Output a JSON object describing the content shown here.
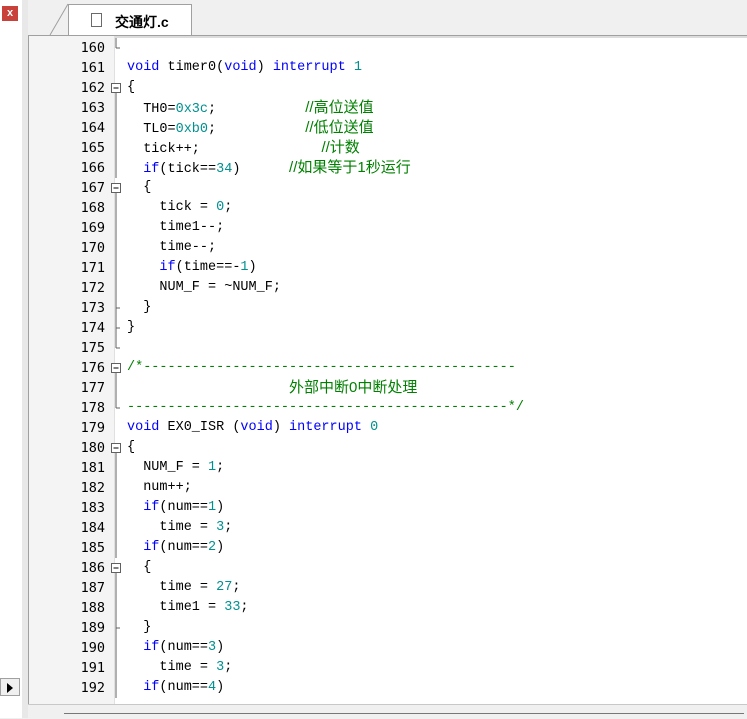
{
  "left_panel": {
    "close_glyph": "x"
  },
  "tab": {
    "label": "交通灯.c"
  },
  "editor": {
    "lines": [
      {
        "n": "160",
        "fold": "end",
        "tokens": []
      },
      {
        "n": "161",
        "fold": "",
        "tokens": [
          {
            "t": "void",
            "c": "kw"
          },
          {
            "t": " timer0("
          },
          {
            "t": "void",
            "c": "kw"
          },
          {
            "t": ") "
          },
          {
            "t": "interrupt",
            "c": "kw"
          },
          {
            "t": " "
          },
          {
            "t": "1",
            "c": "num"
          }
        ]
      },
      {
        "n": "162",
        "fold": "minus",
        "tokens": [
          {
            "t": "{"
          }
        ]
      },
      {
        "n": "163",
        "fold": "bar",
        "tokens": [
          {
            "t": "  TH0="
          },
          {
            "t": "0x3c",
            "c": "num"
          },
          {
            "t": ";           "
          },
          {
            "t": "//高位送值",
            "c": "cmt"
          }
        ]
      },
      {
        "n": "164",
        "fold": "bar",
        "tokens": [
          {
            "t": "  TL0="
          },
          {
            "t": "0xb0",
            "c": "num"
          },
          {
            "t": ";           "
          },
          {
            "t": "//低位送值",
            "c": "cmt"
          }
        ]
      },
      {
        "n": "165",
        "fold": "bar",
        "tokens": [
          {
            "t": "  tick++;               "
          },
          {
            "t": "//计数",
            "c": "cmt"
          }
        ]
      },
      {
        "n": "166",
        "fold": "bar",
        "tokens": [
          {
            "t": "  "
          },
          {
            "t": "if",
            "c": "kw"
          },
          {
            "t": "(tick=="
          },
          {
            "t": "34",
            "c": "num"
          },
          {
            "t": ")      "
          },
          {
            "t": "//如果等于1秒运行",
            "c": "cmt"
          }
        ]
      },
      {
        "n": "167",
        "fold": "minus",
        "tokens": [
          {
            "t": "  {"
          }
        ]
      },
      {
        "n": "168",
        "fold": "bar",
        "tokens": [
          {
            "t": "    tick = "
          },
          {
            "t": "0",
            "c": "num"
          },
          {
            "t": ";"
          }
        ]
      },
      {
        "n": "169",
        "fold": "bar",
        "tokens": [
          {
            "t": "    time1--;"
          }
        ]
      },
      {
        "n": "170",
        "fold": "bar",
        "tokens": [
          {
            "t": "    time--;"
          }
        ]
      },
      {
        "n": "171",
        "fold": "bar",
        "tokens": [
          {
            "t": "    "
          },
          {
            "t": "if",
            "c": "kw"
          },
          {
            "t": "(time==-"
          },
          {
            "t": "1",
            "c": "num"
          },
          {
            "t": ")"
          }
        ]
      },
      {
        "n": "172",
        "fold": "bar",
        "tokens": [
          {
            "t": "    NUM_F = ~NUM_F;"
          }
        ]
      },
      {
        "n": "173",
        "fold": "tick",
        "tokens": [
          {
            "t": "  }"
          }
        ]
      },
      {
        "n": "174",
        "fold": "tick",
        "tokens": [
          {
            "t": "}"
          }
        ]
      },
      {
        "n": "175",
        "fold": "end",
        "tokens": []
      },
      {
        "n": "176",
        "fold": "minus",
        "tokens": [
          {
            "t": "/*----------------------------------------------",
            "c": "cmtline"
          }
        ]
      },
      {
        "n": "177",
        "fold": "bar",
        "tokens": [
          {
            "t": "                    "
          },
          {
            "t": "外部中断0中断处理",
            "c": "cmt"
          }
        ]
      },
      {
        "n": "178",
        "fold": "end",
        "tokens": [
          {
            "t": "-----------------------------------------------*/",
            "c": "cmtline"
          }
        ]
      },
      {
        "n": "179",
        "fold": "",
        "tokens": [
          {
            "t": "void",
            "c": "kw"
          },
          {
            "t": " EX0_ISR ("
          },
          {
            "t": "void",
            "c": "kw"
          },
          {
            "t": ") "
          },
          {
            "t": "interrupt",
            "c": "kw"
          },
          {
            "t": " "
          },
          {
            "t": "0",
            "c": "num"
          }
        ]
      },
      {
        "n": "180",
        "fold": "minus",
        "tokens": [
          {
            "t": "{"
          }
        ]
      },
      {
        "n": "181",
        "fold": "bar",
        "tokens": [
          {
            "t": "  NUM_F = "
          },
          {
            "t": "1",
            "c": "num"
          },
          {
            "t": ";"
          }
        ]
      },
      {
        "n": "182",
        "fold": "bar",
        "tokens": [
          {
            "t": "  num++;"
          }
        ]
      },
      {
        "n": "183",
        "fold": "bar",
        "tokens": [
          {
            "t": "  "
          },
          {
            "t": "if",
            "c": "kw"
          },
          {
            "t": "(num=="
          },
          {
            "t": "1",
            "c": "num"
          },
          {
            "t": ")"
          }
        ]
      },
      {
        "n": "184",
        "fold": "bar",
        "tokens": [
          {
            "t": "    time = "
          },
          {
            "t": "3",
            "c": "num"
          },
          {
            "t": ";"
          }
        ]
      },
      {
        "n": "185",
        "fold": "bar",
        "tokens": [
          {
            "t": "  "
          },
          {
            "t": "if",
            "c": "kw"
          },
          {
            "t": "(num=="
          },
          {
            "t": "2",
            "c": "num"
          },
          {
            "t": ")"
          }
        ]
      },
      {
        "n": "186",
        "fold": "minus",
        "tokens": [
          {
            "t": "  {"
          }
        ]
      },
      {
        "n": "187",
        "fold": "bar",
        "tokens": [
          {
            "t": "    time = "
          },
          {
            "t": "27",
            "c": "num"
          },
          {
            "t": ";"
          }
        ]
      },
      {
        "n": "188",
        "fold": "bar",
        "tokens": [
          {
            "t": "    time1 = "
          },
          {
            "t": "33",
            "c": "num"
          },
          {
            "t": ";"
          }
        ]
      },
      {
        "n": "189",
        "fold": "tick",
        "tokens": [
          {
            "t": "  }"
          }
        ]
      },
      {
        "n": "190",
        "fold": "bar",
        "tokens": [
          {
            "t": "  "
          },
          {
            "t": "if",
            "c": "kw"
          },
          {
            "t": "(num=="
          },
          {
            "t": "3",
            "c": "num"
          },
          {
            "t": ")"
          }
        ]
      },
      {
        "n": "191",
        "fold": "bar",
        "tokens": [
          {
            "t": "    time = "
          },
          {
            "t": "3",
            "c": "num"
          },
          {
            "t": ";"
          }
        ]
      },
      {
        "n": "192",
        "fold": "bar",
        "tokens": [
          {
            "t": "  "
          },
          {
            "t": "if",
            "c": "kw"
          },
          {
            "t": "(num=="
          },
          {
            "t": "4",
            "c": "num"
          },
          {
            "t": ")"
          }
        ]
      }
    ]
  },
  "colors": {
    "keyword": "#0000ff",
    "number": "#009090",
    "comment": "#008000"
  },
  "icons": {
    "tab_icon": "document-icon",
    "left_close": "close-icon",
    "left_scroll": "scroll-right-arrow-icon"
  }
}
